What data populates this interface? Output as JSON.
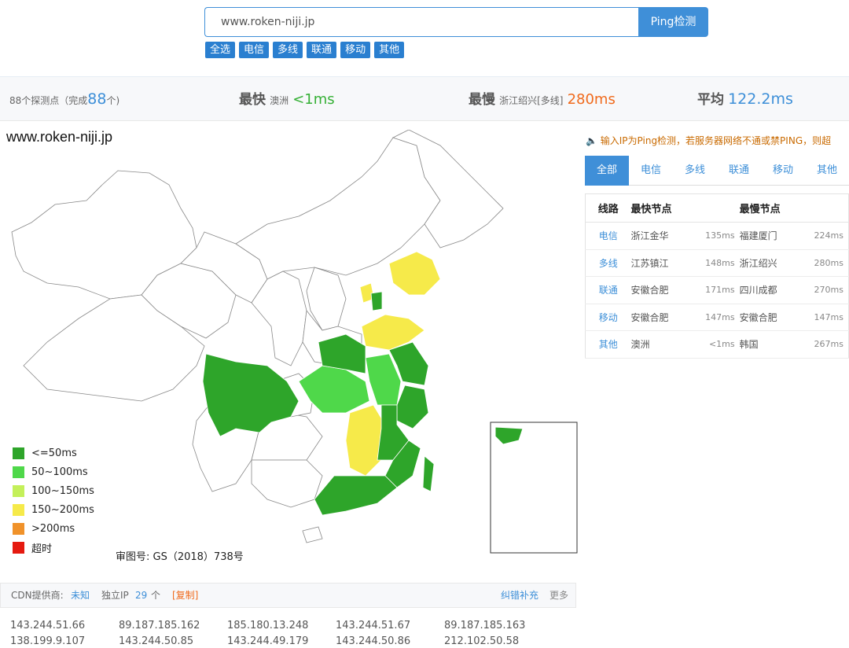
{
  "search": {
    "value": "www.roken-niji.jp",
    "button": "Ping检测"
  },
  "filters": [
    "全选",
    "电信",
    "多线",
    "联通",
    "移动",
    "其他"
  ],
  "stats": {
    "nodes_text": "88个探测点（完成",
    "done": "88",
    "nodes_tail": "个)",
    "fastest_label": "最快",
    "fastest_loc": "澳洲",
    "fastest_val": "<1ms",
    "slowest_label": "最慢",
    "slowest_loc": "浙江绍兴[多线]",
    "slowest_val": "280ms",
    "avg_label": "平均",
    "avg_val": "122.2ms"
  },
  "map": {
    "title": "www.roken-niji.jp",
    "approval": "审图号: GS（2018）738号"
  },
  "legend": [
    {
      "label": "<=50ms",
      "color": "#2ea52a"
    },
    {
      "label": "50~100ms",
      "color": "#4fd84a"
    },
    {
      "label": "100~150ms",
      "color": "#c4f05a"
    },
    {
      "label": "150~200ms",
      "color": "#f6ea4a"
    },
    {
      "label": ">200ms",
      "color": "#f0922a"
    },
    {
      "label": "超时",
      "color": "#e51a10"
    }
  ],
  "notice": "🔈 输入IP为Ping检测，若服务器网络不通或禁PING，则超",
  "tabs": [
    "全部",
    "电信",
    "多线",
    "联通",
    "移动",
    "其他"
  ],
  "table": {
    "headers": [
      "线路",
      "最快节点",
      "最慢节点"
    ],
    "rows": [
      {
        "line": "电信",
        "fast": "浙江金华",
        "fast_ms": "135ms",
        "slow": "福建厦门",
        "slow_ms": "224ms"
      },
      {
        "line": "多线",
        "fast": "江苏镇江",
        "fast_ms": "148ms",
        "slow": "浙江绍兴",
        "slow_ms": "280ms"
      },
      {
        "line": "联通",
        "fast": "安徽合肥",
        "fast_ms": "171ms",
        "slow": "四川成都",
        "slow_ms": "270ms"
      },
      {
        "line": "移动",
        "fast": "安徽合肥",
        "fast_ms": "147ms",
        "slow": "安徽合肥",
        "slow_ms": "147ms"
      },
      {
        "line": "其他",
        "fast": "澳洲",
        "fast_ms": "<1ms",
        "slow": "韩国",
        "slow_ms": "267ms"
      }
    ]
  },
  "cdn": {
    "provider_label": "CDN提供商:",
    "provider": "未知",
    "ip_label": "独立IP",
    "ip_count": "29",
    "ip_unit": "个",
    "copy": "[复制]",
    "report": "纠错补充",
    "more": "更多"
  },
  "ips": [
    [
      "143.244.51.66",
      "89.187.185.162",
      "185.180.13.248",
      "143.244.51.67",
      "89.187.185.163"
    ],
    [
      "138.199.9.107",
      "143.244.50.85",
      "143.244.49.179",
      "143.244.50.86",
      "212.102.50.58"
    ]
  ]
}
